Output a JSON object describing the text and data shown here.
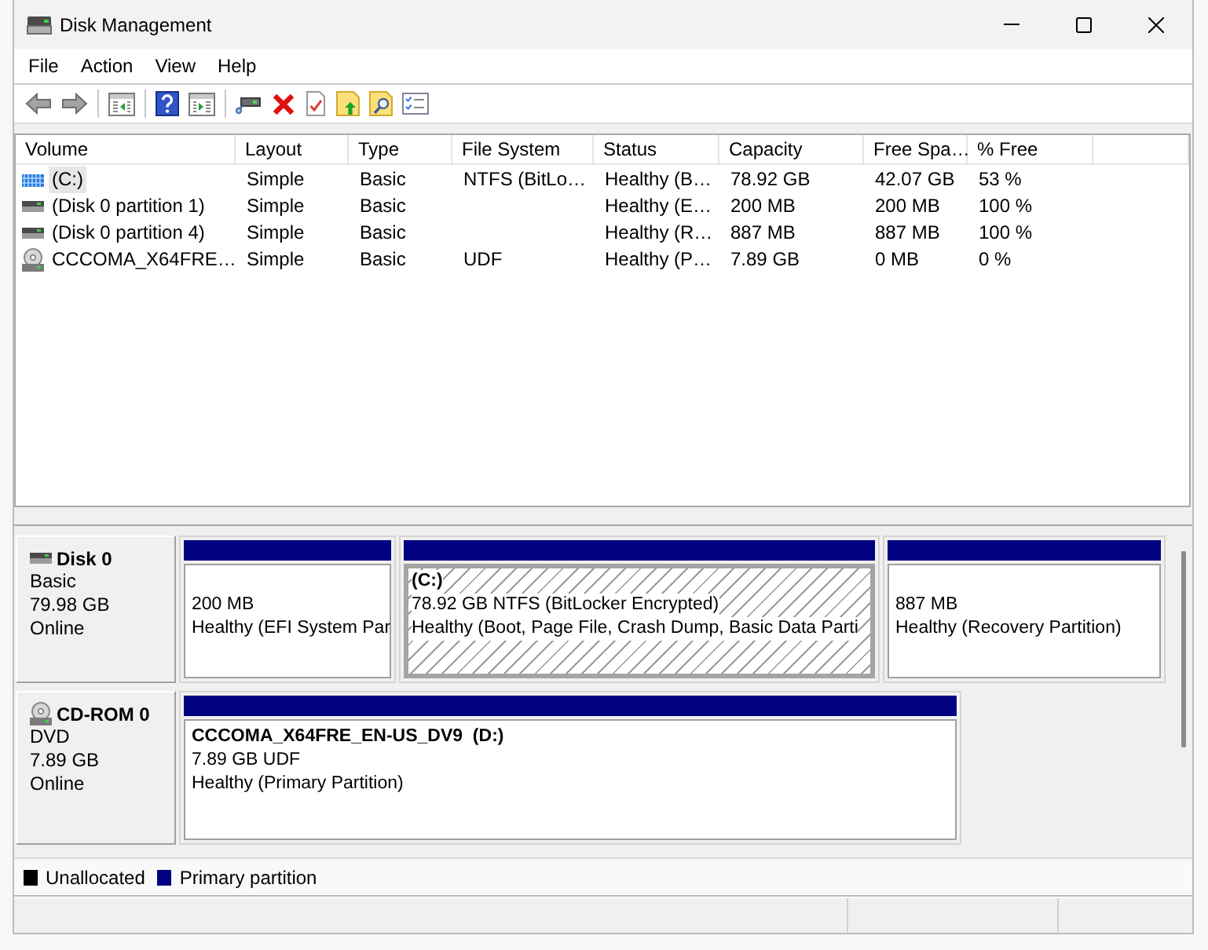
{
  "window": {
    "title": "Disk Management"
  },
  "menu": [
    {
      "label": "File"
    },
    {
      "label": "Action"
    },
    {
      "label": "View"
    },
    {
      "label": "Help"
    }
  ],
  "volume_list": {
    "columns": [
      "Volume",
      "Layout",
      "Type",
      "File System",
      "Status",
      "Capacity",
      "Free Spa…",
      "% Free"
    ],
    "rows": [
      {
        "kind": "encrypted",
        "selected": true,
        "volume": "(C:)",
        "layout": "Simple",
        "type": "Basic",
        "file_system": "NTFS (BitLo…",
        "status": "Healthy (B…",
        "capacity": "78.92 GB",
        "free_space": "42.07 GB",
        "percent_free": "53 %"
      },
      {
        "kind": "partition",
        "selected": false,
        "volume": "(Disk 0 partition 1)",
        "layout": "Simple",
        "type": "Basic",
        "status": "Healthy (E…",
        "capacity": "200 MB",
        "free_space": "200 MB",
        "percent_free": "100 %"
      },
      {
        "kind": "partition",
        "selected": false,
        "volume": "(Disk 0 partition 4)",
        "layout": "Simple",
        "type": "Basic",
        "status": "Healthy (R…",
        "capacity": "887 MB",
        "free_space": "887 MB",
        "percent_free": "100 %"
      },
      {
        "kind": "optical",
        "selected": false,
        "volume": "CCCOMA_X64FRE…",
        "layout": "Simple",
        "type": "Basic",
        "file_system": "UDF",
        "status": "Healthy (P…",
        "capacity": "7.89 GB",
        "free_space": "0 MB",
        "percent_free": "0 %"
      }
    ]
  },
  "disks": [
    {
      "kind": "disk",
      "name": "Disk 0",
      "type": "Basic",
      "size": "79.98 GB",
      "status": "Online",
      "partitions": [
        {
          "kind": "primary",
          "selected": false,
          "lines": [
            "200 MB",
            "Healthy (EFI System Par"
          ]
        },
        {
          "kind": "primary",
          "selected": true,
          "title": "(C:)",
          "lines": [
            "78.92 GB NTFS (BitLocker Encrypted)",
            "Healthy (Boot, Page File, Crash Dump, Basic Data Parti"
          ]
        },
        {
          "kind": "primary",
          "selected": false,
          "lines": [
            "887 MB",
            "Healthy (Recovery Partition)"
          ]
        }
      ]
    },
    {
      "kind": "cdrom",
      "name": "CD-ROM 0",
      "type": "DVD",
      "size": "7.89 GB",
      "status": "Online",
      "partitions": [
        {
          "kind": "primary",
          "selected": false,
          "title": "CCCOMA_X64FRE_EN-US_DV9  (D:)",
          "lines": [
            "7.89 GB UDF",
            "Healthy (Primary Partition)"
          ]
        }
      ]
    }
  ],
  "legend": [
    {
      "label": "Unallocated",
      "color": "#000000"
    },
    {
      "label": "Primary partition",
      "color": "#000080"
    }
  ]
}
